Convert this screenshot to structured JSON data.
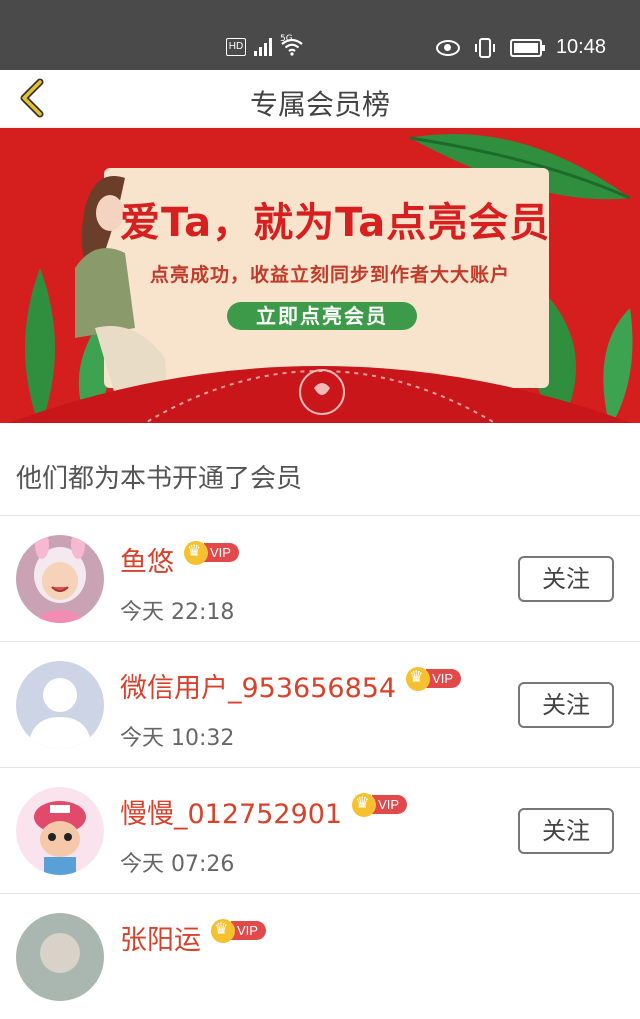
{
  "status_bar": {
    "hd": "HD",
    "network": "5G",
    "time": "10:48",
    "icons": [
      "signal-icon",
      "wifi-icon",
      "eye-icon",
      "vibrate-icon",
      "battery-icon"
    ]
  },
  "nav": {
    "title": "专属会员榜",
    "back_icon": "chevron-left-icon",
    "accent": "#e6c12a"
  },
  "banner": {
    "headline": "爱Ta，就为Ta点亮会员",
    "subline": "点亮成功，收益立刻同步到作者大大账户",
    "button_label": "立即点亮会员",
    "bg": "#d51f1f"
  },
  "section": {
    "title": "他们都为本书开通了会员"
  },
  "members": [
    {
      "name": "鱼悠",
      "badge": "VIP",
      "time": "今天 22:18",
      "follow": "关注",
      "avatar": "baby-photo"
    },
    {
      "name": "微信用户_953656854",
      "badge": "VIP",
      "time": "今天 10:32",
      "follow": "关注",
      "avatar": "default-person"
    },
    {
      "name": "慢慢_012752901",
      "badge": "VIP",
      "time": "今天 07:26",
      "follow": "关注",
      "avatar": "cartoon-character"
    },
    {
      "name": "张阳运",
      "badge": "VIP",
      "time": "",
      "follow": "",
      "avatar": "photo"
    }
  ],
  "colors": {
    "name": "#d9412a",
    "vip": "#e2494b",
    "crown": "#f6c12f"
  }
}
